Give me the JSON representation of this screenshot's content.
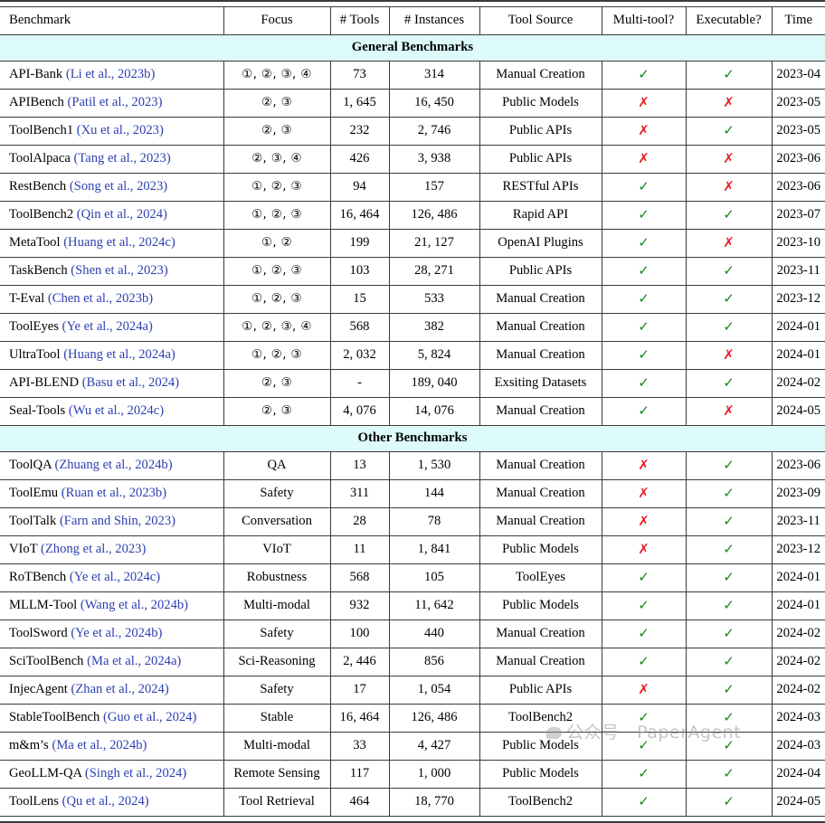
{
  "table": {
    "columns": [
      "Benchmark",
      "Focus",
      "# Tools",
      "# Instances",
      "Tool Source",
      "Multi-tool?",
      "Executable?",
      "Time"
    ],
    "sections": [
      {
        "title": "General Benchmarks",
        "rows": [
          {
            "name": "API-Bank",
            "cite": "(Li et al., 2023b)",
            "focus": "①, ②, ③, ④",
            "tools": "73",
            "instances": "314",
            "source": "Manual Creation",
            "multi": "✓",
            "exec": "✓",
            "time": "2023-04"
          },
          {
            "name": "APIBench",
            "cite": "(Patil et al., 2023)",
            "focus": "②, ③",
            "tools": "1, 645",
            "instances": "16, 450",
            "source": "Public Models",
            "multi": "✗",
            "exec": "✗",
            "time": "2023-05"
          },
          {
            "name": "ToolBench1",
            "cite": "(Xu et al., 2023)",
            "focus": "②, ③",
            "tools": "232",
            "instances": "2, 746",
            "source": "Public APIs",
            "multi": "✗",
            "exec": "✓",
            "time": "2023-05"
          },
          {
            "name": "ToolAlpaca",
            "cite": "(Tang et al., 2023)",
            "focus": "②, ③, ④",
            "tools": "426",
            "instances": "3, 938",
            "source": "Public APIs",
            "multi": "✗",
            "exec": "✗",
            "time": "2023-06"
          },
          {
            "name": "RestBench",
            "cite": "(Song et al., 2023)",
            "focus": "①, ②, ③",
            "tools": "94",
            "instances": "157",
            "source": "RESTful APIs",
            "multi": "✓",
            "exec": "✗",
            "time": "2023-06"
          },
          {
            "name": "ToolBench2",
            "cite": "(Qin et al., 2024)",
            "focus": "①, ②, ③",
            "tools": "16, 464",
            "instances": "126, 486",
            "source": "Rapid API",
            "multi": "✓",
            "exec": "✓",
            "time": "2023-07"
          },
          {
            "name": "MetaTool",
            "cite": "(Huang et al., 2024c)",
            "focus": "①, ②",
            "tools": "199",
            "instances": "21, 127",
            "source": "OpenAI Plugins",
            "multi": "✓",
            "exec": "✗",
            "time": "2023-10"
          },
          {
            "name": "TaskBench",
            "cite": "(Shen et al., 2023)",
            "focus": "①, ②, ③",
            "tools": "103",
            "instances": "28, 271",
            "source": "Public APIs",
            "multi": "✓",
            "exec": "✓",
            "time": "2023-11"
          },
          {
            "name": "T-Eval",
            "cite": "(Chen et al., 2023b)",
            "focus": "①, ②, ③",
            "tools": "15",
            "instances": "533",
            "source": "Manual Creation",
            "multi": "✓",
            "exec": "✓",
            "time": "2023-12"
          },
          {
            "name": "ToolEyes",
            "cite": "(Ye et al., 2024a)",
            "focus": "①, ②, ③, ④",
            "tools": "568",
            "instances": "382",
            "source": "Manual Creation",
            "multi": "✓",
            "exec": "✓",
            "time": "2024-01"
          },
          {
            "name": "UltraTool",
            "cite": "(Huang et al., 2024a)",
            "focus": "①, ②, ③",
            "tools": "2, 032",
            "instances": "5, 824",
            "source": "Manual Creation",
            "multi": "✓",
            "exec": "✗",
            "time": "2024-01"
          },
          {
            "name": "API-BLEND",
            "cite": "(Basu et al., 2024)",
            "focus": "②, ③",
            "tools": "-",
            "instances": "189, 040",
            "source": "Exsiting Datasets",
            "multi": "✓",
            "exec": "✓",
            "time": "2024-02"
          },
          {
            "name": "Seal-Tools",
            "cite": "(Wu et al., 2024c)",
            "focus": "②, ③",
            "tools": "4, 076",
            "instances": "14, 076",
            "source": "Manual Creation",
            "multi": "✓",
            "exec": "✗",
            "time": "2024-05"
          }
        ]
      },
      {
        "title": "Other Benchmarks",
        "rows": [
          {
            "name": "ToolQA",
            "cite": "(Zhuang et al., 2024b)",
            "focus": "QA",
            "tools": "13",
            "instances": "1, 530",
            "source": "Manual Creation",
            "multi": "✗",
            "exec": "✓",
            "time": "2023-06"
          },
          {
            "name": "ToolEmu",
            "cite": "(Ruan et al., 2023b)",
            "focus": "Safety",
            "tools": "311",
            "instances": "144",
            "source": "Manual Creation",
            "multi": "✗",
            "exec": "✓",
            "time": "2023-09"
          },
          {
            "name": "ToolTalk",
            "cite": "(Farn and Shin, 2023)",
            "focus": "Conversation",
            "tools": "28",
            "instances": "78",
            "source": "Manual Creation",
            "multi": "✗",
            "exec": "✓",
            "time": "2023-11"
          },
          {
            "name": "VIoT",
            "cite": "(Zhong et al., 2023)",
            "focus": "VIoT",
            "tools": "11",
            "instances": "1, 841",
            "source": "Public Models",
            "multi": "✗",
            "exec": "✓",
            "time": "2023-12"
          },
          {
            "name": "RoTBench",
            "cite": "(Ye et al., 2024c)",
            "focus": "Robustness",
            "tools": "568",
            "instances": "105",
            "source": "ToolEyes",
            "multi": "✓",
            "exec": "✓",
            "time": "2024-01"
          },
          {
            "name": "MLLM-Tool",
            "cite": "(Wang et al., 2024b)",
            "focus": "Multi-modal",
            "tools": "932",
            "instances": "11, 642",
            "source": "Public Models",
            "multi": "✓",
            "exec": "✓",
            "time": "2024-01"
          },
          {
            "name": "ToolSword",
            "cite": "(Ye et al., 2024b)",
            "focus": "Safety",
            "tools": "100",
            "instances": "440",
            "source": "Manual Creation",
            "multi": "✓",
            "exec": "✓",
            "time": "2024-02"
          },
          {
            "name": "SciToolBench",
            "cite": "(Ma et al., 2024a)",
            "focus": "Sci-Reasoning",
            "tools": "2, 446",
            "instances": "856",
            "source": "Manual Creation",
            "multi": "✓",
            "exec": "✓",
            "time": "2024-02"
          },
          {
            "name": "InjecAgent",
            "cite": "(Zhan et al., 2024)",
            "focus": "Safety",
            "tools": "17",
            "instances": "1, 054",
            "source": "Public APIs",
            "multi": "✗",
            "exec": "✓",
            "time": "2024-02"
          },
          {
            "name": "StableToolBench",
            "cite": "(Guo et al., 2024)",
            "focus": "Stable",
            "tools": "16, 464",
            "instances": "126, 486",
            "source": "ToolBench2",
            "multi": "✓",
            "exec": "✓",
            "time": "2024-03"
          },
          {
            "name": "m&m’s",
            "cite": "(Ma et al., 2024b)",
            "focus": "Multi-modal",
            "tools": "33",
            "instances": "4, 427",
            "source": "Public Models",
            "multi": "✓",
            "exec": "✓",
            "time": "2024-03"
          },
          {
            "name": "GeoLLM-QA",
            "cite": "(Singh et al., 2024)",
            "focus": "Remote Sensing",
            "tools": "117",
            "instances": "1, 000",
            "source": "Public Models",
            "multi": "✓",
            "exec": "✓",
            "time": "2024-04"
          },
          {
            "name": "ToolLens",
            "cite": "(Qu et al., 2024)",
            "focus": "Tool Retrieval",
            "tools": "464",
            "instances": "18, 770",
            "source": "ToolBench2",
            "multi": "✓",
            "exec": "✓",
            "time": "2024-05"
          }
        ]
      }
    ]
  },
  "watermark": {
    "text": "公众号 · PaperAgent"
  },
  "colors": {
    "section_background": "#ddfbfb",
    "citation": "#2c3fb0",
    "check": "#128a12",
    "cross": "#ec1c24",
    "rule": "#3a3a3a"
  }
}
